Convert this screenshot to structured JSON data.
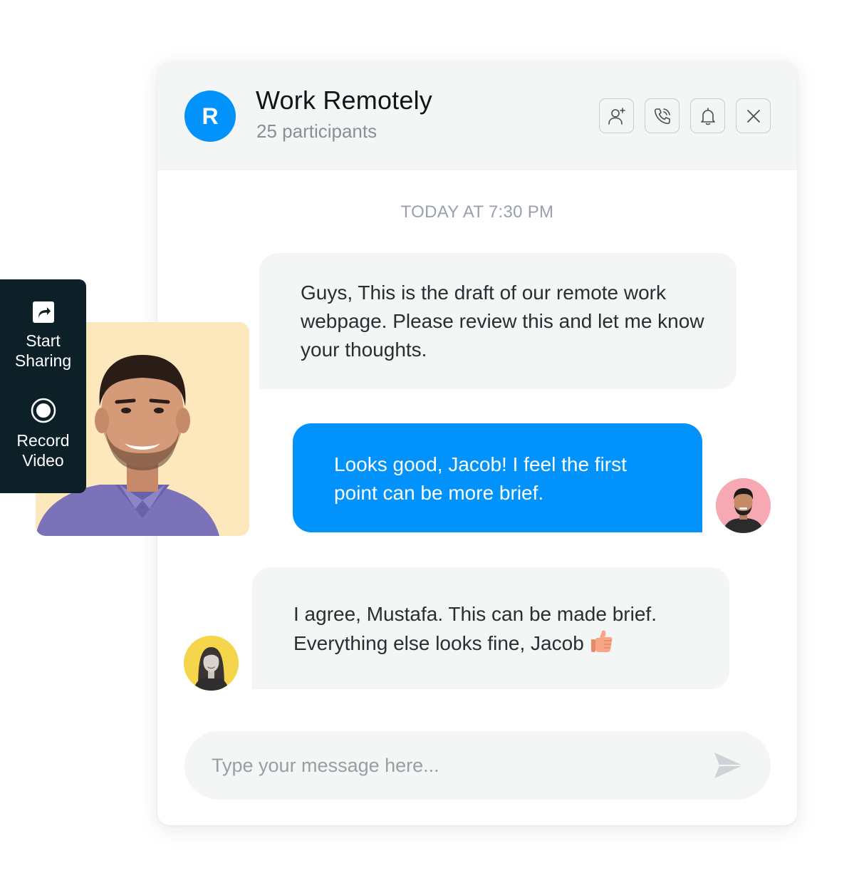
{
  "chat": {
    "group_initial": "R",
    "title": "Work Remotely",
    "participants": "25 participants",
    "timestamp": "TODAY AT 7:30 PM",
    "messages": [
      {
        "sender": "incoming",
        "text": "Guys, This is the draft of our remote work webpage. Please review this and let me know your thoughts."
      },
      {
        "sender": "outgoing",
        "text": "Looks good, Jacob! I feel the first point can be more brief."
      },
      {
        "sender": "incoming",
        "text": "I agree, Mustafa. This can be made brief. Everything else looks fine, Jacob",
        "emoji": "thumbs-up"
      }
    ],
    "composer_placeholder": "Type your message here..."
  },
  "header_actions": [
    {
      "icon": "add-user-icon"
    },
    {
      "icon": "phone-call-icon"
    },
    {
      "icon": "bell-icon"
    },
    {
      "icon": "close-icon"
    }
  ],
  "toolbar": {
    "share_label": "Start\nSharing",
    "record_label": "Record\nVideo"
  },
  "colors": {
    "accent": "#0193fb",
    "toolbar_bg": "#0d2028",
    "bubble_in": "#f4f5f5",
    "video_bg": "#fde8be"
  }
}
